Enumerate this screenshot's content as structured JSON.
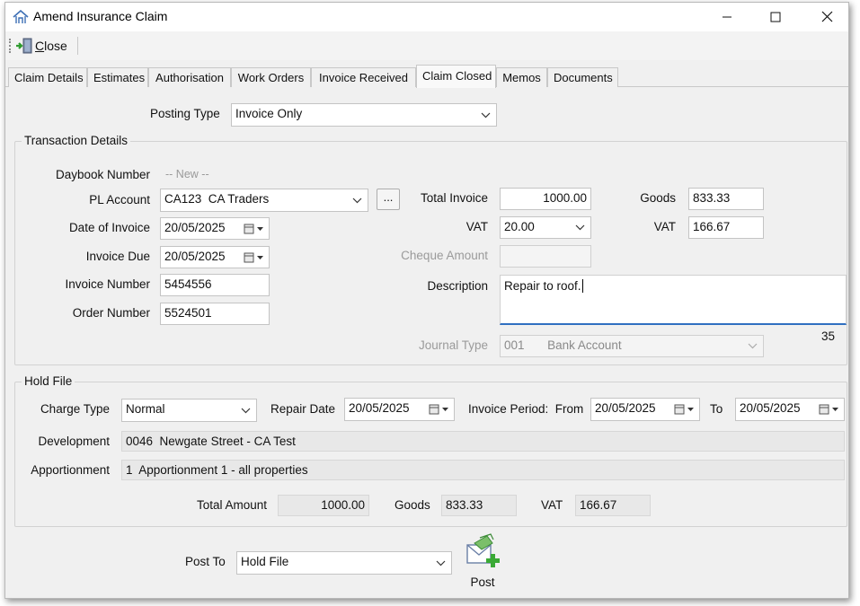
{
  "window": {
    "title": "Amend Insurance Claim",
    "controls": {
      "minimize": "—",
      "maximize": "☐",
      "close": "✕"
    }
  },
  "toolbar": {
    "close_label": "Close",
    "close_accel": "C",
    "close_rest": "lose"
  },
  "tabs": [
    {
      "label": "Claim Details"
    },
    {
      "label": "Estimates"
    },
    {
      "label": "Authorisation"
    },
    {
      "label": "Work Orders"
    },
    {
      "label": "Invoice Received"
    },
    {
      "label": "Claim Closed",
      "active": true
    },
    {
      "label": "Memos"
    },
    {
      "label": "Documents"
    }
  ],
  "posting": {
    "label": "Posting Type",
    "value": "Invoice Only"
  },
  "transaction": {
    "title": "Transaction Details",
    "daybook_label": "Daybook Number",
    "daybook_value": "-- New --",
    "pl_account_label": "PL Account",
    "pl_account_value": "CA123  CA Traders",
    "browse_label": "...",
    "date_invoice_label": "Date of Invoice",
    "date_invoice_value": "20/05/2025",
    "invoice_due_label": "Invoice Due",
    "invoice_due_value": "20/05/2025",
    "invoice_number_label": "Invoice Number",
    "invoice_number_value": "5454556",
    "order_number_label": "Order Number",
    "order_number_value": "5524501",
    "total_invoice_label": "Total Invoice",
    "total_invoice_value": "1000.00",
    "vat_rate_label": "VAT",
    "vat_rate_value": "20.00",
    "cheque_label": "Cheque Amount",
    "cheque_value": "",
    "description_label": "Description",
    "description_value": "Repair to roof.",
    "char_count": "35",
    "goods_label": "Goods",
    "goods_value": "833.33",
    "vat_label": "VAT",
    "vat_value": "166.67",
    "journal_label": "Journal Type",
    "journal_code": "001",
    "journal_name": "Bank Account"
  },
  "hold": {
    "title": "Hold File",
    "charge_type_label": "Charge Type",
    "charge_type_value": "Normal",
    "repair_date_label": "Repair Date",
    "repair_date_value": "20/05/2025",
    "period_label": "Invoice Period:  From",
    "period_from_value": "20/05/2025",
    "period_to_label": "To",
    "period_to_value": "20/05/2025",
    "development_label": "Development",
    "development_value": "0046  Newgate Street - CA Test",
    "apportionment_label": "Apportionment",
    "apportionment_value": "1  Apportionment 1 - all properties",
    "total_amount_label": "Total Amount",
    "total_amount_value": "1000.00",
    "goods_label": "Goods",
    "goods_value": "833.33",
    "vat_label": "VAT",
    "vat_value": "166.67"
  },
  "post": {
    "post_to_label": "Post To",
    "post_to_value": "Hold File",
    "post_button_label": "Post"
  },
  "colors": {
    "focus_border": "#2f6fc0",
    "post_icon_green": "#3aa935"
  }
}
